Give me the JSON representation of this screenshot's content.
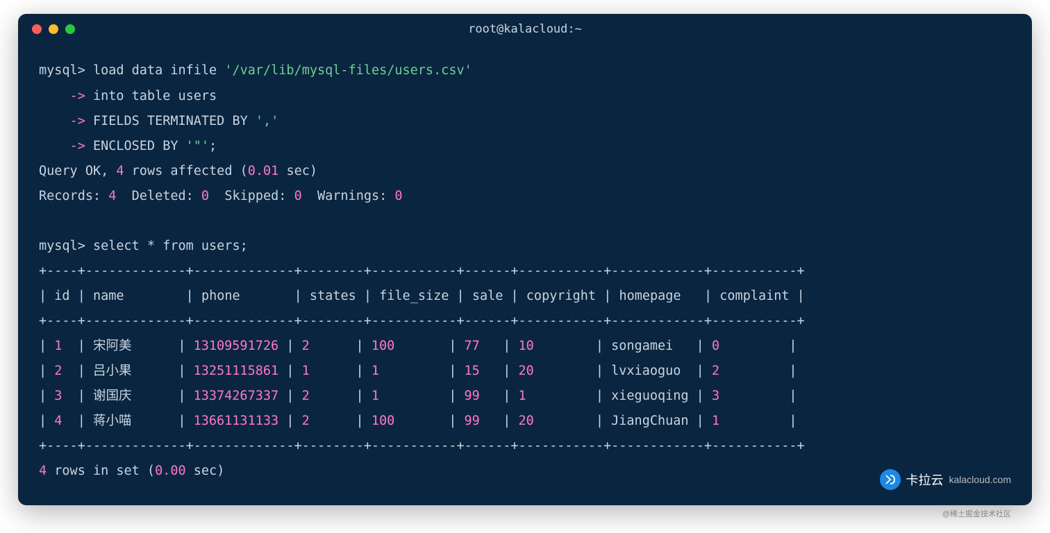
{
  "window": {
    "title": "root@kalacloud:~"
  },
  "session": {
    "prompt1": "mysql>",
    "cmd1": " load data infile ",
    "cmd1_str": "'/var/lib/mysql-files/users.csv'",
    "cont_arrow": "    -> ",
    "cont1": "into table users",
    "cont2": "FIELDS TERMINATED BY ",
    "cont2_str": "','",
    "cont3": "ENCLOSED BY ",
    "cont3_str": "'\"'",
    "cont3_end": ";",
    "result1_a": "Query OK, ",
    "result1_b": "4",
    "result1_c": " rows affected (",
    "result1_d": "0.01",
    "result1_e": " sec)",
    "result2_a": "Records: ",
    "result2_b": "4",
    "result2_c": "  Deleted: ",
    "result2_d": "0",
    "result2_e": "  Skipped: ",
    "result2_f": "0",
    "result2_g": "  Warnings: ",
    "result2_h": "0",
    "prompt2": "mysql>",
    "cmd2": " select * from users;",
    "footer_a": "4",
    "footer_b": " rows in set (",
    "footer_c": "0.00",
    "footer_d": " sec)"
  },
  "table": {
    "border": "+----+-------------+-------------+--------+-----------+------+-----------+------------+-----------+",
    "header": "| id | name        | phone       | states | file_size | sale | copyright | homepage   | complaint |",
    "columns": [
      "id",
      "name",
      "phone",
      "states",
      "file_size",
      "sale",
      "copyright",
      "homepage",
      "complaint"
    ],
    "rows": [
      {
        "id": "1",
        "name": "宋阿美",
        "phone": "13109591726",
        "states": "2",
        "file_size": "100",
        "sale": "77",
        "copyright": "10",
        "homepage": "songamei",
        "complaint": "0"
      },
      {
        "id": "2",
        "name": "吕小果",
        "phone": "13251115861",
        "states": "1",
        "file_size": "1",
        "sale": "15",
        "copyright": "20",
        "homepage": "lvxiaoguo",
        "complaint": "2"
      },
      {
        "id": "3",
        "name": "谢国庆",
        "phone": "13374267337",
        "states": "2",
        "file_size": "1",
        "sale": "99",
        "copyright": "1",
        "homepage": "xieguoqing",
        "complaint": "3"
      },
      {
        "id": "4",
        "name": "蒋小喵",
        "phone": "13661131133",
        "states": "2",
        "file_size": "100",
        "sale": "99",
        "copyright": "20",
        "homepage": "JiangChuan",
        "complaint": "1"
      }
    ]
  },
  "branding": {
    "main": "卡拉云",
    "sub": "kalacloud.com",
    "watermark": "@稀土掘金技术社区"
  }
}
